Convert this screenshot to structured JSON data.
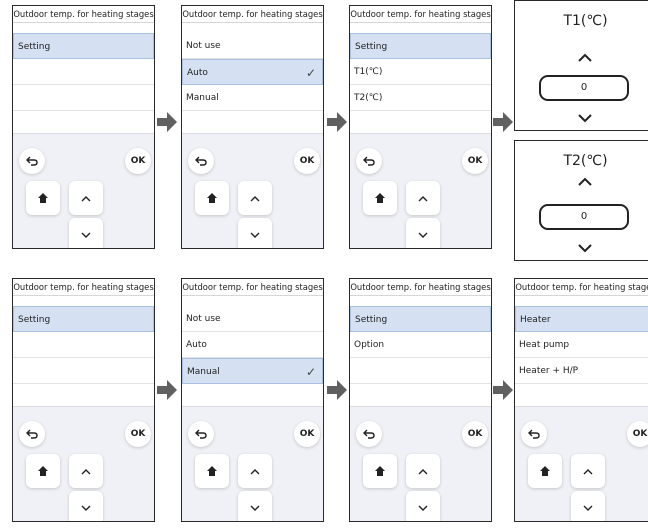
{
  "panels": [
    {
      "title": "Outdoor temp. for heating stages",
      "items": [
        {
          "label": "Setting",
          "selected": true
        }
      ],
      "check_index": -1
    },
    {
      "title": "Outdoor temp. for heating stages",
      "items": [
        {
          "label": "Not use",
          "selected": false
        },
        {
          "label": "Auto",
          "selected": true
        },
        {
          "label": "Manual",
          "selected": false
        }
      ],
      "check_index": 1
    },
    {
      "title": "Outdoor temp. for heating stages",
      "items": [
        {
          "label": "Setting",
          "selected": true
        },
        {
          "label": "T1(℃)",
          "selected": false
        },
        {
          "label": "T2(℃)",
          "selected": false
        }
      ],
      "check_index": -1
    },
    {
      "title": "Outdoor temp. for heating stages",
      "items": [
        {
          "label": "Setting",
          "selected": true
        }
      ],
      "check_index": -1
    },
    {
      "title": "Outdoor temp. for heating stages",
      "items": [
        {
          "label": "Not use",
          "selected": false
        },
        {
          "label": "Auto",
          "selected": false
        },
        {
          "label": "Manual",
          "selected": true
        }
      ],
      "check_index": 2
    },
    {
      "title": "Outdoor temp. for heating stages",
      "items": [
        {
          "label": "Setting",
          "selected": true
        },
        {
          "label": "Option",
          "selected": false
        }
      ],
      "check_index": -1
    },
    {
      "title": "Outdoor temp. for heating stages",
      "items": [
        {
          "label": "Heater",
          "selected": true
        },
        {
          "label": "Heat pump",
          "selected": false
        },
        {
          "label": "Heater + H/P",
          "selected": false
        }
      ],
      "check_index": -1
    }
  ],
  "keypad": {
    "ok_label": "OK",
    "back_icon": "back-arrow-icon",
    "home_icon": "home-icon",
    "up_icon": "chevron-up-icon",
    "down_icon": "chevron-down-icon"
  },
  "value_panels": [
    {
      "title": "T1(℃)",
      "value": "0"
    },
    {
      "title": "T2(℃)",
      "value": "0"
    }
  ],
  "check_glyph": "✓",
  "colors": {
    "selected_bg": "#d5e1f2",
    "keypad_bg": "#f0f1f6",
    "arrow": "#606060"
  }
}
